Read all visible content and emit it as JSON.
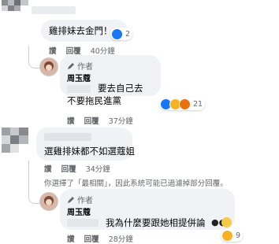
{
  "comments": [
    {
      "text": "雞排妹去金門！",
      "reaction_count": "2",
      "actions": {
        "like": "讚",
        "reply": "回覆",
        "time": "40分鐘"
      }
    },
    {
      "author_badge": "作者",
      "author_name": "周玉蔻",
      "text_line1": "要去自己去",
      "text_line2": "不要拖民進黨",
      "reaction_count": "21",
      "actions": {
        "like": "讚",
        "reply": "回覆",
        "time": "37分鐘"
      }
    },
    {
      "text": "選雞排妹都不如選蔻姐",
      "actions": {
        "like": "讚",
        "reply": "回覆",
        "time": "34分鐘"
      }
    },
    {
      "notice": "你選擇了「最相關」，因此系統可能已過濾掉部分回覆。"
    },
    {
      "author_badge": "作者",
      "author_name": "周玉蔻",
      "text": "我為什麼要跟她相提併論",
      "reaction_count": "9",
      "actions": {
        "like": "讚",
        "reply": "回覆",
        "time": "28分鐘"
      }
    }
  ],
  "colors": {
    "bubble": "#f0f2f5",
    "meta": "#65676b",
    "like_blue": "#1877f2",
    "haha_yellow": "#f7b125"
  }
}
